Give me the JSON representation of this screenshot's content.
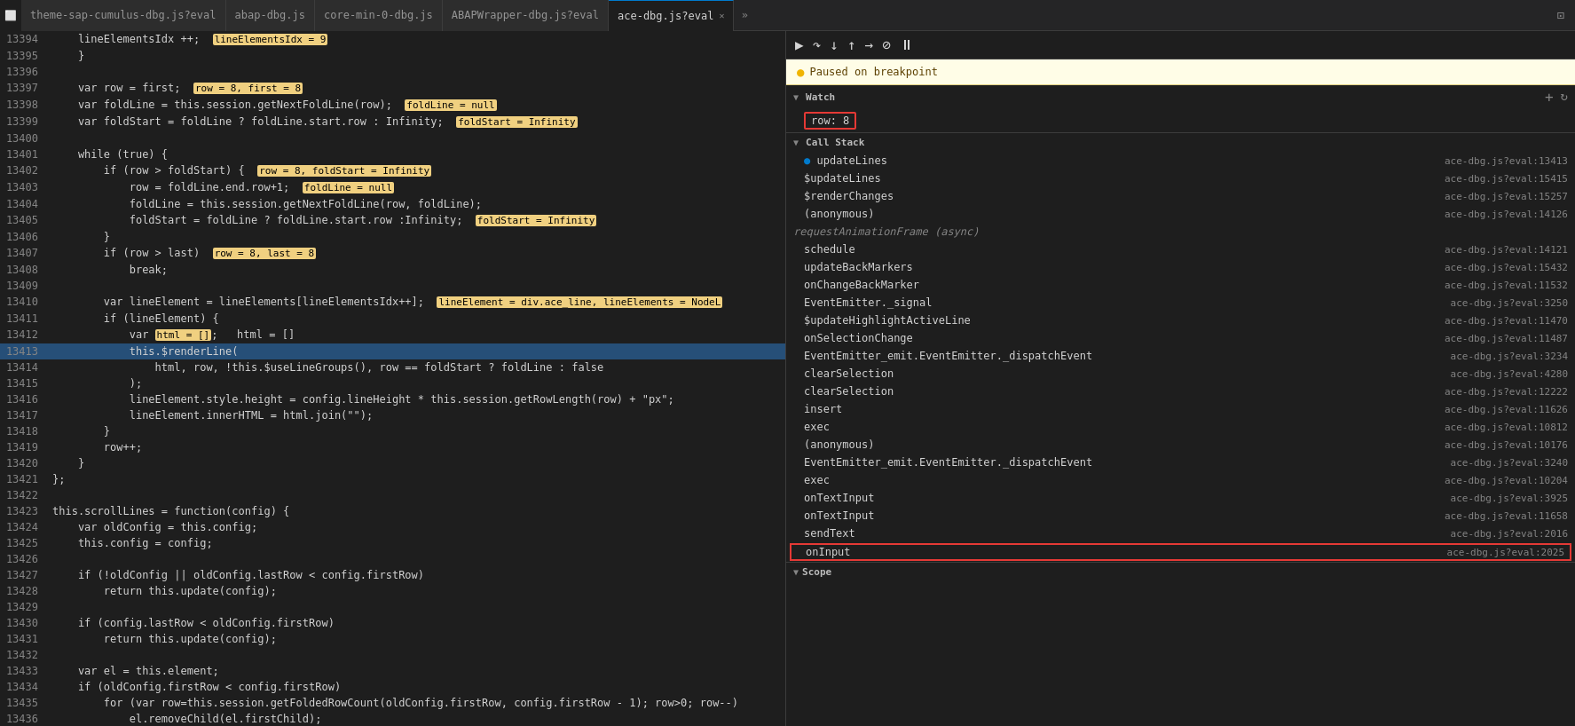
{
  "tabs": [
    {
      "label": "theme-sap-cumulus-dbg.js?eval",
      "active": false,
      "closable": false
    },
    {
      "label": "abap-dbg.js",
      "active": false,
      "closable": false
    },
    {
      "label": "core-min-0-dbg.js",
      "active": false,
      "closable": false
    },
    {
      "label": "ABAPWrapper-dbg.js?eval",
      "active": false,
      "closable": false
    },
    {
      "label": "ace-dbg.js?eval",
      "active": true,
      "closable": true
    }
  ],
  "paused_message": "Paused on breakpoint",
  "watch": {
    "title": "Watch",
    "item": "row: 8"
  },
  "call_stack": {
    "title": "Call Stack",
    "items": [
      {
        "name": "updateLines",
        "location": "ace-dbg.js?eval:13413",
        "active": true,
        "highlighted": false
      },
      {
        "name": "$updateLines",
        "location": "ace-dbg.js?eval:15415",
        "highlighted": false
      },
      {
        "name": "$renderChanges",
        "location": "ace-dbg.js?eval:15257",
        "highlighted": false
      },
      {
        "name": "(anonymous)",
        "location": "ace-dbg.js?eval:14126",
        "highlighted": false
      },
      {
        "name": "requestAnimationFrame (async)",
        "location": "",
        "async": true,
        "highlighted": false
      },
      {
        "name": "schedule",
        "location": "ace-dbg.js?eval:14121",
        "highlighted": false
      },
      {
        "name": "updateBackMarkers",
        "location": "ace-dbg.js?eval:15432",
        "highlighted": false
      },
      {
        "name": "onChangeBackMarker",
        "location": "ace-dbg.js?eval:11532",
        "highlighted": false
      },
      {
        "name": "EventEmitter._signal",
        "location": "ace-dbg.js?eval:3250",
        "highlighted": false
      },
      {
        "name": "$updateHighlightActiveLine",
        "location": "ace-dbg.js?eval:11470",
        "highlighted": false
      },
      {
        "name": "onSelectionChange",
        "location": "ace-dbg.js?eval:11487",
        "highlighted": false
      },
      {
        "name": "EventEmitter_emit.EventEmitter._dispatchEvent",
        "location": "ace-dbg.js?eval:3234",
        "highlighted": false
      },
      {
        "name": "clearSelection",
        "location": "ace-dbg.js?eval:4280",
        "highlighted": false
      },
      {
        "name": "clearSelection",
        "location": "ace-dbg.js?eval:12222",
        "highlighted": false
      },
      {
        "name": "insert",
        "location": "ace-dbg.js?eval:11626",
        "highlighted": false
      },
      {
        "name": "exec",
        "location": "ace-dbg.js?eval:10812",
        "highlighted": false
      },
      {
        "name": "(anonymous)",
        "location": "ace-dbg.js?eval:10176",
        "highlighted": false
      },
      {
        "name": "EventEmitter_emit.EventEmitter._dispatchEvent",
        "location": "ace-dbg.js?eval:3240",
        "highlighted": false
      },
      {
        "name": "exec",
        "location": "ace-dbg.js?eval:10204",
        "highlighted": false
      },
      {
        "name": "onTextInput",
        "location": "ace-dbg.js?eval:3925",
        "highlighted": false
      },
      {
        "name": "onTextInput",
        "location": "ace-dbg.js?eval:11658",
        "highlighted": false
      },
      {
        "name": "sendText",
        "location": "ace-dbg.js?eval:2016",
        "highlighted": false
      },
      {
        "name": "onInput",
        "location": "ace-dbg.js?eval:2025",
        "highlighted": true
      }
    ]
  },
  "scope": {
    "title": "Scope"
  },
  "code_lines": [
    {
      "num": 13394,
      "content": "    lineElementsIdx ++;  lineElementsIdx = 9",
      "highlight_words": [
        "lineElementsIdx = 9"
      ],
      "active": false
    },
    {
      "num": 13395,
      "content": "    }",
      "active": false
    },
    {
      "num": 13396,
      "content": "",
      "active": false
    },
    {
      "num": 13397,
      "content": "    var row = first;  row = 8, first = 8",
      "highlight_words": [
        "row = 8, first = 8"
      ],
      "active": false
    },
    {
      "num": 13398,
      "content": "    var foldLine = this.session.getNextFoldLine(row);  foldLine = null",
      "highlight_words": [
        "foldLine = null"
      ],
      "active": false
    },
    {
      "num": 13399,
      "content": "    var foldStart = foldLine ? foldLine.start.row : Infinity;  foldStart = Infinity",
      "highlight_words": [
        "foldStart = Infinity"
      ],
      "active": false
    },
    {
      "num": 13400,
      "content": "",
      "active": false
    },
    {
      "num": 13401,
      "content": "    while (true) {",
      "active": false
    },
    {
      "num": 13402,
      "content": "        if (row > foldStart) {  row = 8, foldStart = Infinity",
      "highlight_words": [
        "row = 8, foldStart = Infinity"
      ],
      "active": false
    },
    {
      "num": 13403,
      "content": "            row = foldLine.end.row+1;  foldLine = null",
      "highlight_words": [
        "foldLine = null"
      ],
      "active": false
    },
    {
      "num": 13404,
      "content": "            foldLine = this.session.getNextFoldLine(row, foldLine);",
      "active": false
    },
    {
      "num": 13405,
      "content": "            foldStart = foldLine ? foldLine.start.row :Infinity;  foldStart = Infinity",
      "highlight_words": [
        "foldStart = Infinity"
      ],
      "active": false
    },
    {
      "num": 13406,
      "content": "        }",
      "active": false
    },
    {
      "num": 13407,
      "content": "        if (row > last)  row = 8, last = 8",
      "highlight_words": [
        "row = 8, last = 8"
      ],
      "active": false
    },
    {
      "num": 13408,
      "content": "            break;",
      "active": false
    },
    {
      "num": 13409,
      "content": "",
      "active": false
    },
    {
      "num": 13410,
      "content": "        var lineElement = lineElements[lineElementsIdx++];  lineElement = div.ace_line, lineElements = NodeL",
      "highlight_words": [
        "lineElement = div.ace_line, lineElements = NodeL"
      ],
      "active": false
    },
    {
      "num": 13411,
      "content": "        if (lineElement) {",
      "active": false
    },
    {
      "num": 13412,
      "content": "            var html = [];   html = []",
      "highlight_words": [
        "html = []"
      ],
      "active": false
    },
    {
      "num": 13413,
      "content": "            this.$renderLine(",
      "active": true
    },
    {
      "num": 13414,
      "content": "                html, row, !this.$useLineGroups(), row == foldStart ? foldLine : false",
      "active": false
    },
    {
      "num": 13415,
      "content": "            );",
      "active": false
    },
    {
      "num": 13416,
      "content": "            lineElement.style.height = config.lineHeight * this.session.getRowLength(row) + \"px\";",
      "active": false
    },
    {
      "num": 13417,
      "content": "            lineElement.innerHTML = html.join(\"\");",
      "active": false
    },
    {
      "num": 13418,
      "content": "        }",
      "active": false
    },
    {
      "num": 13419,
      "content": "        row++;",
      "active": false
    },
    {
      "num": 13420,
      "content": "    }",
      "active": false
    },
    {
      "num": 13421,
      "content": "};",
      "active": false
    },
    {
      "num": 13422,
      "content": "",
      "active": false
    },
    {
      "num": 13423,
      "content": "this.scrollLines = function(config) {",
      "active": false
    },
    {
      "num": 13424,
      "content": "    var oldConfig = this.config;",
      "active": false
    },
    {
      "num": 13425,
      "content": "    this.config = config;",
      "active": false
    },
    {
      "num": 13426,
      "content": "",
      "active": false
    },
    {
      "num": 13427,
      "content": "    if (!oldConfig || oldConfig.lastRow < config.firstRow)",
      "active": false
    },
    {
      "num": 13428,
      "content": "        return this.update(config);",
      "active": false
    },
    {
      "num": 13429,
      "content": "",
      "active": false
    },
    {
      "num": 13430,
      "content": "    if (config.lastRow < oldConfig.firstRow)",
      "active": false
    },
    {
      "num": 13431,
      "content": "        return this.update(config);",
      "active": false
    },
    {
      "num": 13432,
      "content": "",
      "active": false
    },
    {
      "num": 13433,
      "content": "    var el = this.element;",
      "active": false
    },
    {
      "num": 13434,
      "content": "    if (oldConfig.firstRow < config.firstRow)",
      "active": false
    },
    {
      "num": 13435,
      "content": "        for (var row=this.session.getFoldedRowCount(oldConfig.firstRow, config.firstRow - 1); row>0; row--)",
      "active": false
    },
    {
      "num": 13436,
      "content": "            el.removeChild(el.firstChild);",
      "active": false
    }
  ]
}
